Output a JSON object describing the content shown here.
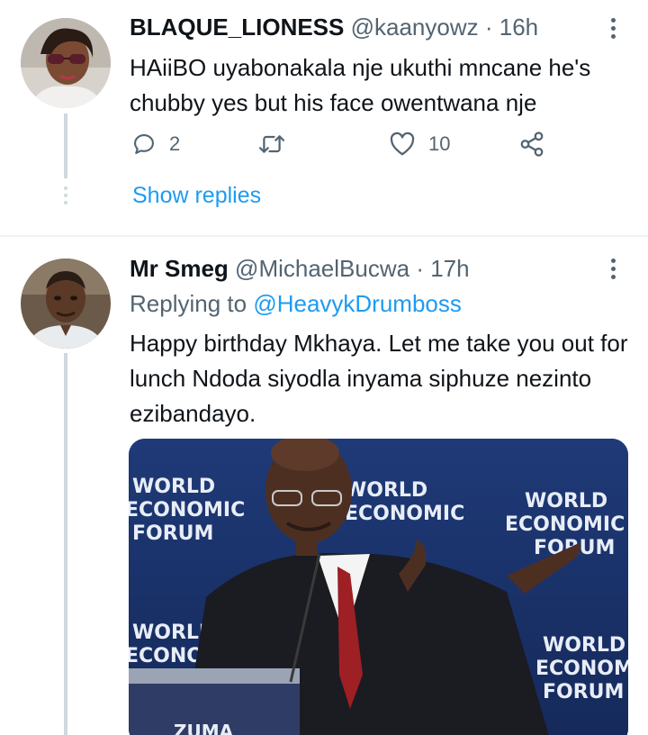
{
  "tweets": [
    {
      "display_name": "BLAQUE_LIONESS",
      "handle": "@kaanyowz",
      "separator": "·",
      "time": "16h",
      "text": "HAiiBO uyabonakala nje ukuthi mncane he's chubby yes but his face owentwana nje",
      "reply_count": "2",
      "like_count": "10",
      "show_replies": "Show replies"
    },
    {
      "display_name": "Mr Smeg",
      "handle": "@MichaelBucwa",
      "separator": "·",
      "time": "17h",
      "replying_to_label": "Replying to",
      "replying_to_handle": "@HeavykDrumboss",
      "text": "Happy birthday Mkhaya. Let me take you out for lunch Ndoda siyodla inyama siphuze nezinto ezibandayo.",
      "media": {
        "backdrop_words": [
          "WORLD",
          "ECONOMIC",
          "FORUM"
        ],
        "nameplate": "ZUMA"
      }
    }
  ],
  "colors": {
    "accent": "#1d9bf0",
    "secondary_text": "#536471",
    "thread_line": "#cfd9de"
  },
  "icons": [
    "reply-icon",
    "retweet-icon",
    "like-icon",
    "share-icon",
    "more-icon"
  ]
}
